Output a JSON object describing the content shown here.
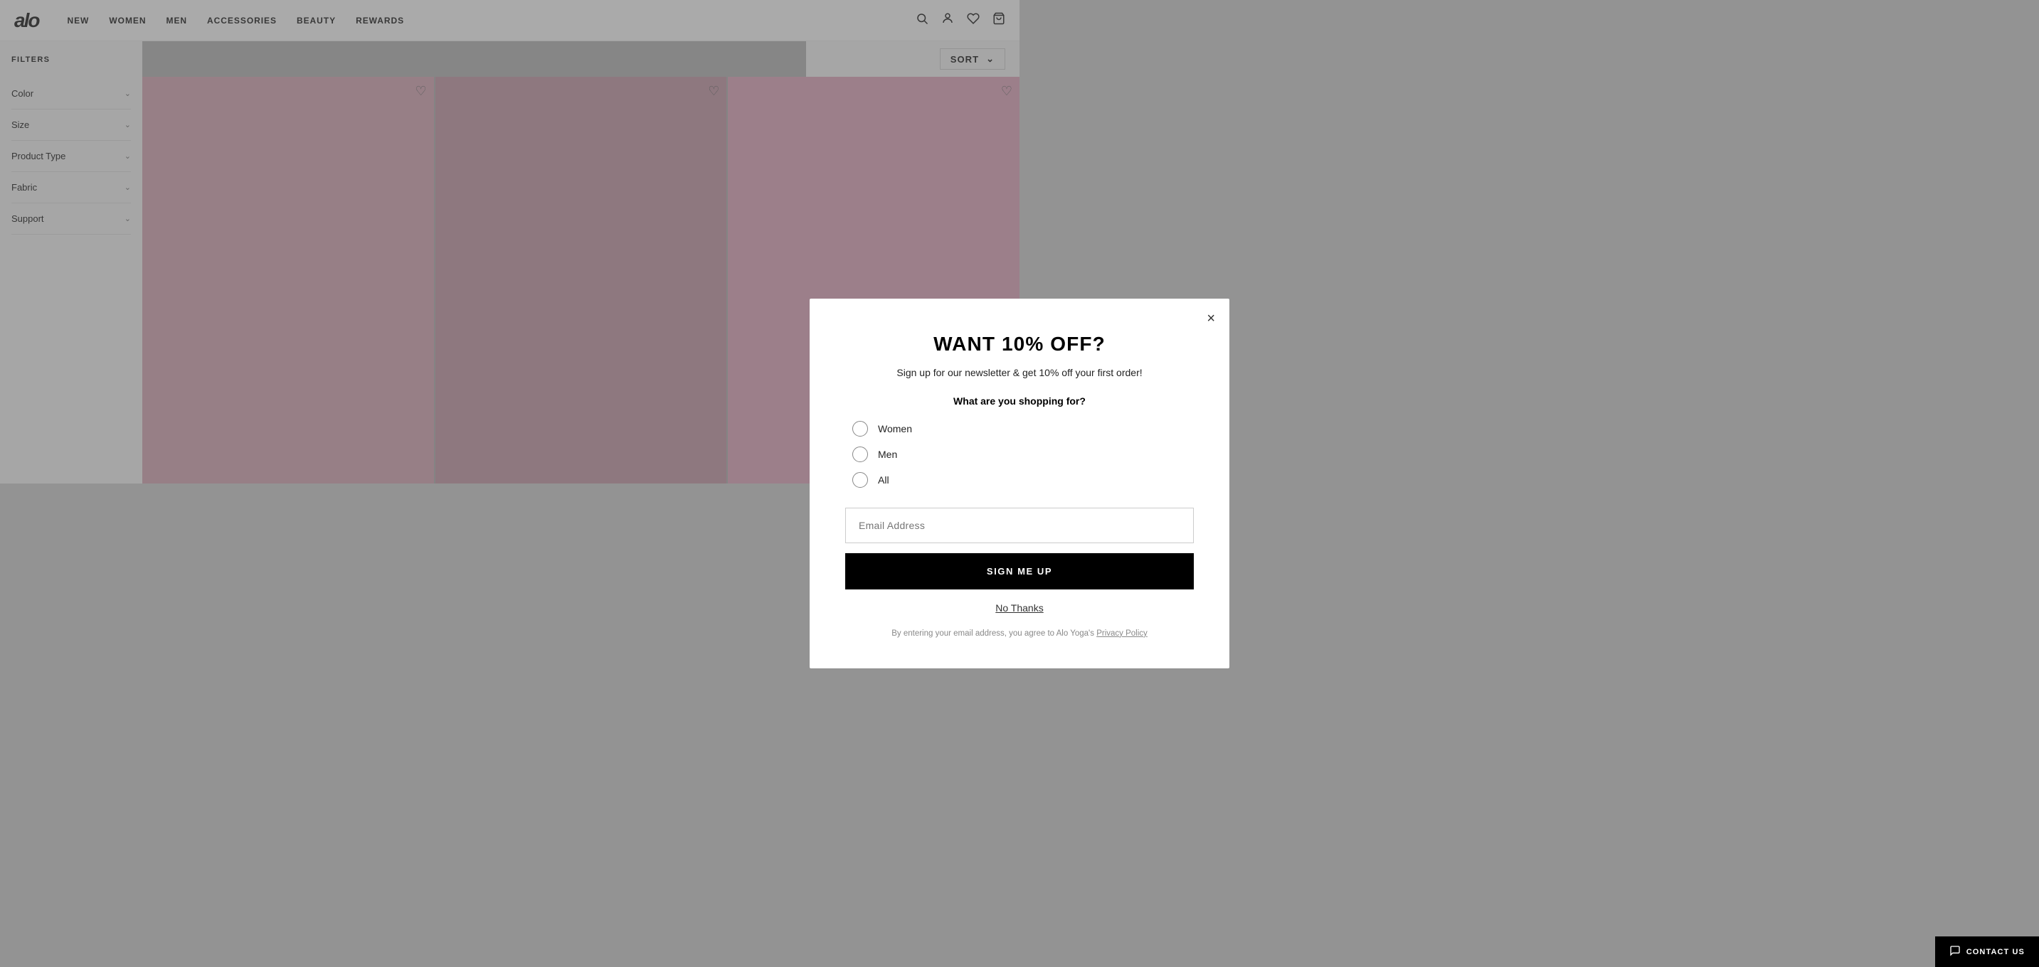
{
  "navbar": {
    "logo": "alo",
    "links": [
      {
        "label": "NEW",
        "key": "new"
      },
      {
        "label": "WOMEN",
        "key": "women"
      },
      {
        "label": "MEN",
        "key": "men"
      },
      {
        "label": "ACCESSORIES",
        "key": "accessories"
      },
      {
        "label": "BEAUTY",
        "key": "beauty"
      },
      {
        "label": "REWARDS",
        "key": "rewards"
      }
    ],
    "icons": {
      "search": "🔍",
      "account": "👤",
      "wishlist": "♡",
      "bag": "🛍"
    }
  },
  "filters": {
    "title": "FILTERS",
    "items": [
      {
        "label": "Color"
      },
      {
        "label": "Size"
      },
      {
        "label": "Product Type"
      },
      {
        "label": "Fabric"
      },
      {
        "label": "Support"
      }
    ]
  },
  "sort": {
    "label": "SORT",
    "chevron": "⌄"
  },
  "modal": {
    "title": "WANT 10% OFF?",
    "subtitle": "Sign up for our newsletter & get 10% off your first order!",
    "question": "What are you shopping for?",
    "options": [
      {
        "label": "Women",
        "key": "women"
      },
      {
        "label": "Men",
        "key": "men"
      },
      {
        "label": "All",
        "key": "all"
      }
    ],
    "email_placeholder": "Email Address",
    "sign_up_label": "SIGN ME UP",
    "no_thanks_label": "No Thanks",
    "privacy_text": "By entering your email address, you agree to Alo Yoga's ",
    "privacy_link": "Privacy Policy",
    "close_icon": "×"
  },
  "contact_us": {
    "label": "CONTACT US",
    "chat_icon": "💬"
  }
}
